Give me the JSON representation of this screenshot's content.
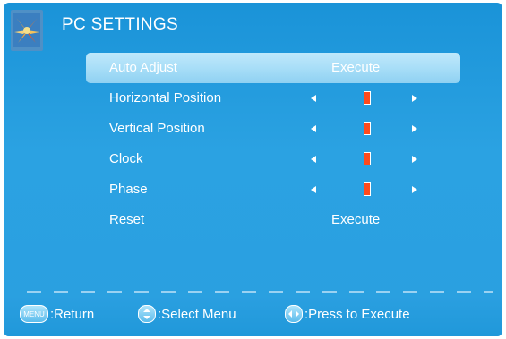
{
  "header": {
    "title": "PC SETTINGS",
    "icon": "picture-settings-icon"
  },
  "menu": {
    "items": [
      {
        "label": "Auto Adjust",
        "value": "Execute",
        "selected": true
      },
      {
        "label": "Horizontal Position",
        "type": "slider"
      },
      {
        "label": "Vertical Position",
        "type": "slider"
      },
      {
        "label": "Clock",
        "type": "slider"
      },
      {
        "label": "Phase",
        "type": "slider"
      },
      {
        "label": "Reset",
        "value": "Execute"
      }
    ]
  },
  "footer": {
    "menu_key": "MENU",
    "return_label": ":Return",
    "select_label": ":Select Menu",
    "execute_label": ":Press to Execute"
  },
  "colors": {
    "marker": "#ff4a1c",
    "selected_row": "#a6ddf7",
    "background": "#2ba2e2"
  }
}
